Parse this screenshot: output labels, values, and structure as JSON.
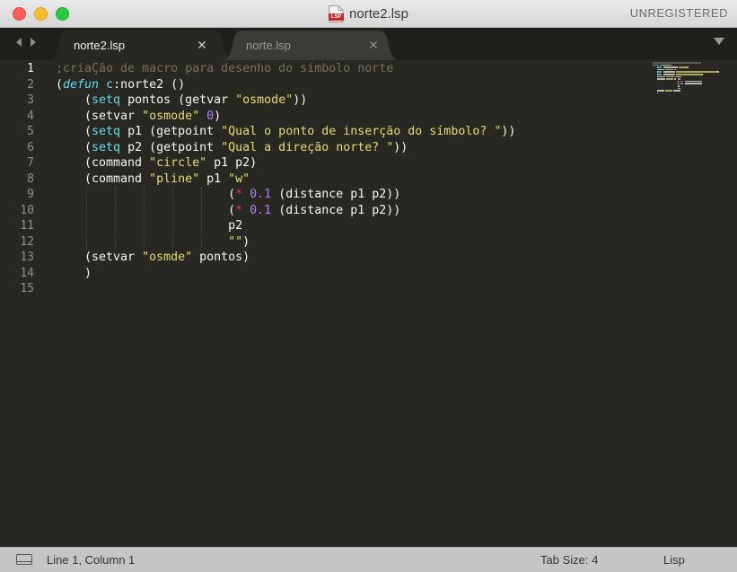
{
  "window": {
    "title": "norte2.lsp",
    "file_icon_label": "LSP",
    "registration": "UNREGISTERED"
  },
  "tabs": [
    {
      "label": "norte2.lsp",
      "active": true
    },
    {
      "label": "norte.lsp",
      "active": false
    }
  ],
  "icons": {
    "back": "chevron-left-icon",
    "forward": "chevron-right-icon",
    "tab_close": "close-icon",
    "tab_menu": "triangle-down-icon",
    "panel": "panel-toggle-icon"
  },
  "editor": {
    "line_numbers": [
      "1",
      "2",
      "3",
      "4",
      "5",
      "6",
      "7",
      "8",
      "9",
      "10",
      "11",
      "12",
      "13",
      "14",
      "15"
    ],
    "current_line": 1,
    "lines": [
      [
        {
          "t": ";criaÇão de macro para desenho do símbolo norte",
          "c": "comment"
        }
      ],
      [
        {
          "t": "(",
          "c": "plain"
        },
        {
          "t": "defun",
          "c": "keyword"
        },
        {
          "t": " ",
          "c": "plain"
        },
        {
          "t": "c",
          "c": "func"
        },
        {
          "t": ":norte2 ()",
          "c": "plain"
        }
      ],
      [
        {
          "t": "    (",
          "c": "plain"
        },
        {
          "t": "setq",
          "c": "func"
        },
        {
          "t": " pontos (getvar ",
          "c": "plain"
        },
        {
          "t": "\"osmode\"",
          "c": "string"
        },
        {
          "t": "))",
          "c": "plain"
        }
      ],
      [
        {
          "t": "    (setvar ",
          "c": "plain"
        },
        {
          "t": "\"osmode\"",
          "c": "string"
        },
        {
          "t": " ",
          "c": "plain"
        },
        {
          "t": "0",
          "c": "number"
        },
        {
          "t": ")",
          "c": "plain"
        }
      ],
      [
        {
          "t": "    (",
          "c": "plain"
        },
        {
          "t": "setq",
          "c": "func"
        },
        {
          "t": " p1 (getpoint ",
          "c": "plain"
        },
        {
          "t": "\"Qual o ponto de inserção do símbolo? \"",
          "c": "string"
        },
        {
          "t": "))",
          "c": "plain"
        }
      ],
      [
        {
          "t": "    (",
          "c": "plain"
        },
        {
          "t": "setq",
          "c": "func"
        },
        {
          "t": " p2 (getpoint ",
          "c": "plain"
        },
        {
          "t": "\"Qual a direção norte? \"",
          "c": "string"
        },
        {
          "t": "))",
          "c": "plain"
        }
      ],
      [
        {
          "t": "    (command ",
          "c": "plain"
        },
        {
          "t": "\"circle\"",
          "c": "string"
        },
        {
          "t": " p1 p2)",
          "c": "plain"
        }
      ],
      [
        {
          "t": "    (command ",
          "c": "plain"
        },
        {
          "t": "\"pline\"",
          "c": "string"
        },
        {
          "t": " p1 ",
          "c": "plain"
        },
        {
          "t": "\"w\"",
          "c": "string"
        }
      ],
      [
        {
          "t": "                        (",
          "c": "plain"
        },
        {
          "t": "*",
          "c": "op"
        },
        {
          "t": " ",
          "c": "plain"
        },
        {
          "t": "0.1",
          "c": "number"
        },
        {
          "t": " (distance p1 p2))",
          "c": "plain"
        }
      ],
      [
        {
          "t": "                        (",
          "c": "plain"
        },
        {
          "t": "*",
          "c": "op"
        },
        {
          "t": " ",
          "c": "plain"
        },
        {
          "t": "0.1",
          "c": "number"
        },
        {
          "t": " (distance p1 p2))",
          "c": "plain"
        }
      ],
      [
        {
          "t": "                        p2",
          "c": "plain"
        }
      ],
      [
        {
          "t": "                        ",
          "c": "plain"
        },
        {
          "t": "\"\"",
          "c": "string"
        },
        {
          "t": ")",
          "c": "plain"
        }
      ],
      [
        {
          "t": "    (setvar ",
          "c": "plain"
        },
        {
          "t": "\"osmde\"",
          "c": "string"
        },
        {
          "t": " pontos)",
          "c": "plain"
        }
      ],
      [
        {
          "t": "    )",
          "c": "plain"
        }
      ],
      [
        {
          "t": "",
          "c": "plain"
        }
      ]
    ]
  },
  "statusbar": {
    "position": "Line 1, Column 1",
    "tab_size": "Tab Size: 4",
    "syntax": "Lisp"
  },
  "colors": {
    "background": "#272822",
    "comment": "#75715e",
    "keyword": "#66d9ef",
    "string": "#e6db74",
    "number": "#ae81ff",
    "operator": "#f92672",
    "text": "#f8f8f2"
  }
}
